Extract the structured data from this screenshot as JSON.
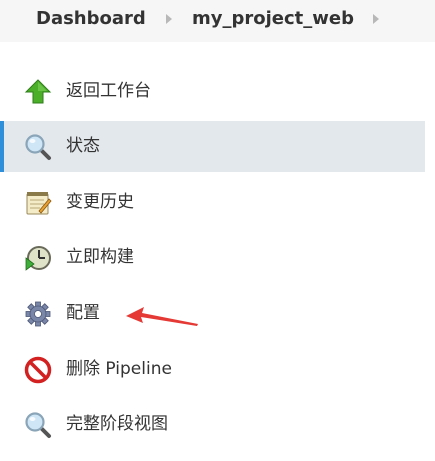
{
  "breadcrumb": {
    "items": [
      "Dashboard",
      "my_project_web"
    ]
  },
  "tasks": [
    {
      "label": "返回工作台",
      "icon": "up-arrow-icon",
      "active": false
    },
    {
      "label": "状态",
      "icon": "search-icon",
      "active": true
    },
    {
      "label": "变更历史",
      "icon": "notepad-icon",
      "active": false
    },
    {
      "label": "立即构建",
      "icon": "clock-icon",
      "active": false
    },
    {
      "label": "配置",
      "icon": "gear-icon",
      "active": false
    },
    {
      "label": "删除 Pipeline",
      "icon": "no-entry-icon",
      "active": false
    },
    {
      "label": "完整阶段视图",
      "icon": "search-icon",
      "active": false
    }
  ],
  "colors": {
    "active_accent": "#2f8fd8",
    "active_bg": "#e3e8ec",
    "annotation": "#e53935"
  }
}
